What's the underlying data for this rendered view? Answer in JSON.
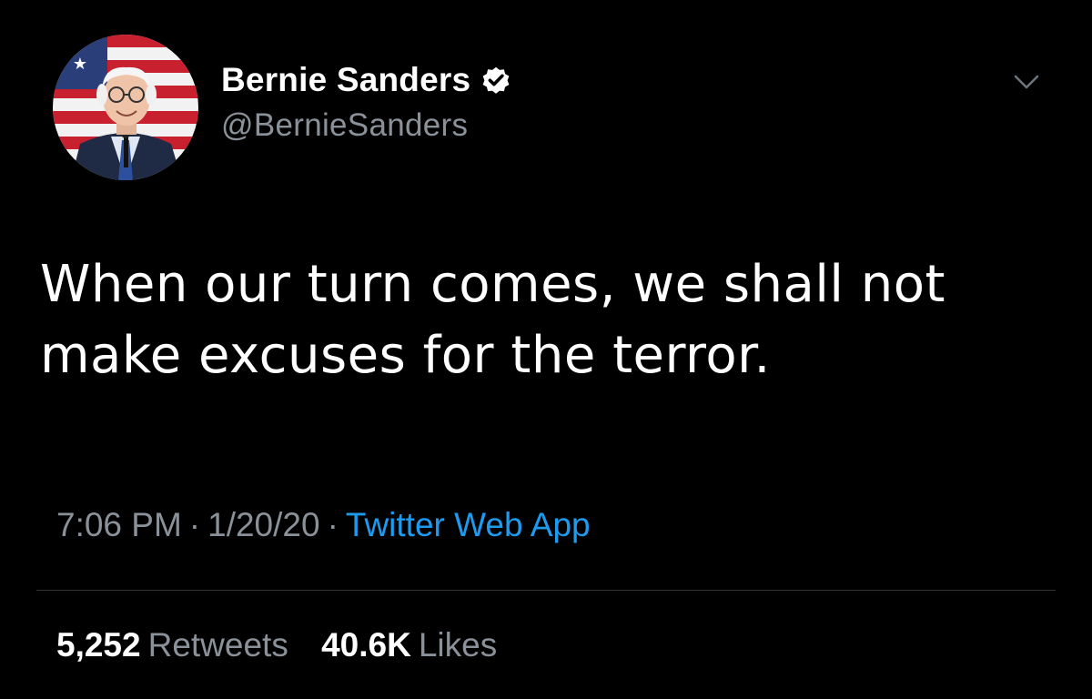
{
  "author": {
    "display_name": "Bernie Sanders",
    "handle": "@BernieSanders",
    "verified": true
  },
  "tweet": {
    "text": "When our turn comes, we shall not make excuses for the terror.",
    "time": "7:06 PM",
    "date": "1/20/20",
    "separator": "·",
    "source": "Twitter Web App"
  },
  "stats": {
    "retweets_count": "5,252",
    "retweets_label": "Retweets",
    "likes_count": "40.6K",
    "likes_label": "Likes"
  },
  "icons": {
    "verified": "verified-badge-icon",
    "menu": "chevron-down-icon"
  },
  "colors": {
    "background": "#000000",
    "text": "#ffffff",
    "secondary": "#8a9199",
    "link": "#1d9bf0",
    "divider": "#2f3336"
  }
}
